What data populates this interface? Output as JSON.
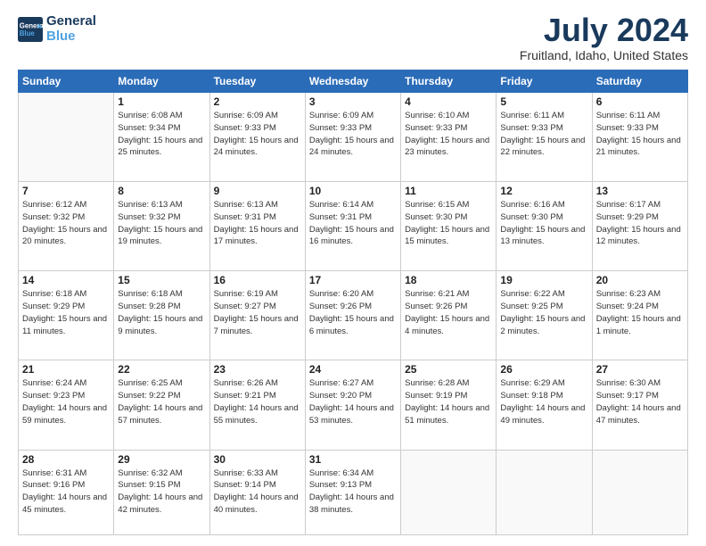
{
  "header": {
    "logo_line1": "General",
    "logo_line2": "Blue",
    "title": "July 2024",
    "location": "Fruitland, Idaho, United States"
  },
  "days_of_week": [
    "Sunday",
    "Monday",
    "Tuesday",
    "Wednesday",
    "Thursday",
    "Friday",
    "Saturday"
  ],
  "weeks": [
    [
      {
        "day": "",
        "info": ""
      },
      {
        "day": "1",
        "info": "Sunrise: 6:08 AM\nSunset: 9:34 PM\nDaylight: 15 hours\nand 25 minutes."
      },
      {
        "day": "2",
        "info": "Sunrise: 6:09 AM\nSunset: 9:33 PM\nDaylight: 15 hours\nand 24 minutes."
      },
      {
        "day": "3",
        "info": "Sunrise: 6:09 AM\nSunset: 9:33 PM\nDaylight: 15 hours\nand 24 minutes."
      },
      {
        "day": "4",
        "info": "Sunrise: 6:10 AM\nSunset: 9:33 PM\nDaylight: 15 hours\nand 23 minutes."
      },
      {
        "day": "5",
        "info": "Sunrise: 6:11 AM\nSunset: 9:33 PM\nDaylight: 15 hours\nand 22 minutes."
      },
      {
        "day": "6",
        "info": "Sunrise: 6:11 AM\nSunset: 9:33 PM\nDaylight: 15 hours\nand 21 minutes."
      }
    ],
    [
      {
        "day": "7",
        "info": "Sunrise: 6:12 AM\nSunset: 9:32 PM\nDaylight: 15 hours\nand 20 minutes."
      },
      {
        "day": "8",
        "info": "Sunrise: 6:13 AM\nSunset: 9:32 PM\nDaylight: 15 hours\nand 19 minutes."
      },
      {
        "day": "9",
        "info": "Sunrise: 6:13 AM\nSunset: 9:31 PM\nDaylight: 15 hours\nand 17 minutes."
      },
      {
        "day": "10",
        "info": "Sunrise: 6:14 AM\nSunset: 9:31 PM\nDaylight: 15 hours\nand 16 minutes."
      },
      {
        "day": "11",
        "info": "Sunrise: 6:15 AM\nSunset: 9:30 PM\nDaylight: 15 hours\nand 15 minutes."
      },
      {
        "day": "12",
        "info": "Sunrise: 6:16 AM\nSunset: 9:30 PM\nDaylight: 15 hours\nand 13 minutes."
      },
      {
        "day": "13",
        "info": "Sunrise: 6:17 AM\nSunset: 9:29 PM\nDaylight: 15 hours\nand 12 minutes."
      }
    ],
    [
      {
        "day": "14",
        "info": "Sunrise: 6:18 AM\nSunset: 9:29 PM\nDaylight: 15 hours\nand 11 minutes."
      },
      {
        "day": "15",
        "info": "Sunrise: 6:18 AM\nSunset: 9:28 PM\nDaylight: 15 hours\nand 9 minutes."
      },
      {
        "day": "16",
        "info": "Sunrise: 6:19 AM\nSunset: 9:27 PM\nDaylight: 15 hours\nand 7 minutes."
      },
      {
        "day": "17",
        "info": "Sunrise: 6:20 AM\nSunset: 9:26 PM\nDaylight: 15 hours\nand 6 minutes."
      },
      {
        "day": "18",
        "info": "Sunrise: 6:21 AM\nSunset: 9:26 PM\nDaylight: 15 hours\nand 4 minutes."
      },
      {
        "day": "19",
        "info": "Sunrise: 6:22 AM\nSunset: 9:25 PM\nDaylight: 15 hours\nand 2 minutes."
      },
      {
        "day": "20",
        "info": "Sunrise: 6:23 AM\nSunset: 9:24 PM\nDaylight: 15 hours\nand 1 minute."
      }
    ],
    [
      {
        "day": "21",
        "info": "Sunrise: 6:24 AM\nSunset: 9:23 PM\nDaylight: 14 hours\nand 59 minutes."
      },
      {
        "day": "22",
        "info": "Sunrise: 6:25 AM\nSunset: 9:22 PM\nDaylight: 14 hours\nand 57 minutes."
      },
      {
        "day": "23",
        "info": "Sunrise: 6:26 AM\nSunset: 9:21 PM\nDaylight: 14 hours\nand 55 minutes."
      },
      {
        "day": "24",
        "info": "Sunrise: 6:27 AM\nSunset: 9:20 PM\nDaylight: 14 hours\nand 53 minutes."
      },
      {
        "day": "25",
        "info": "Sunrise: 6:28 AM\nSunset: 9:19 PM\nDaylight: 14 hours\nand 51 minutes."
      },
      {
        "day": "26",
        "info": "Sunrise: 6:29 AM\nSunset: 9:18 PM\nDaylight: 14 hours\nand 49 minutes."
      },
      {
        "day": "27",
        "info": "Sunrise: 6:30 AM\nSunset: 9:17 PM\nDaylight: 14 hours\nand 47 minutes."
      }
    ],
    [
      {
        "day": "28",
        "info": "Sunrise: 6:31 AM\nSunset: 9:16 PM\nDaylight: 14 hours\nand 45 minutes."
      },
      {
        "day": "29",
        "info": "Sunrise: 6:32 AM\nSunset: 9:15 PM\nDaylight: 14 hours\nand 42 minutes."
      },
      {
        "day": "30",
        "info": "Sunrise: 6:33 AM\nSunset: 9:14 PM\nDaylight: 14 hours\nand 40 minutes."
      },
      {
        "day": "31",
        "info": "Sunrise: 6:34 AM\nSunset: 9:13 PM\nDaylight: 14 hours\nand 38 minutes."
      },
      {
        "day": "",
        "info": ""
      },
      {
        "day": "",
        "info": ""
      },
      {
        "day": "",
        "info": ""
      }
    ]
  ]
}
